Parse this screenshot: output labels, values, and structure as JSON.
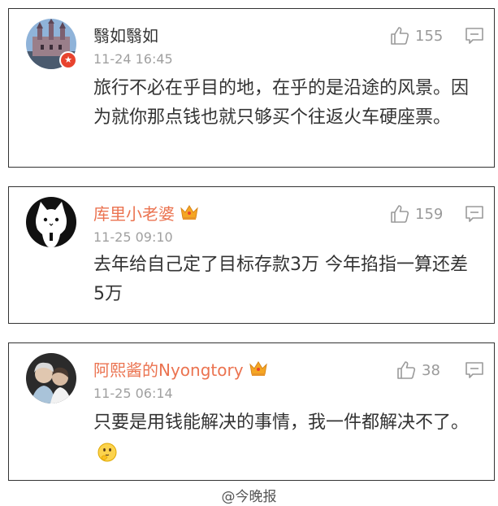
{
  "comments": [
    {
      "username": "翳如翳如",
      "timestamp": "11-24 16:45",
      "likes": "155",
      "content": "旅行不必在乎目的地，在乎的是沿途的风景。因为就你那点钱也就只够买个往返火车硬座票。",
      "verified_badge": "star-badge-icon",
      "has_crown": false,
      "has_emoji": false
    },
    {
      "username": "库里小老婆",
      "timestamp": "11-25 09:10",
      "likes": "159",
      "content": "去年给自己定了目标存款3万 今年掐指一算还差5万",
      "has_crown": true,
      "has_emoji": false
    },
    {
      "username": "阿熙酱的Nyongtory",
      "timestamp": "11-25 06:14",
      "likes": "38",
      "content": "只要是用钱能解决的事情，我一件都解决不了。",
      "has_crown": true,
      "has_emoji": true,
      "emoji": "thinking-face-icon"
    }
  ],
  "watermark": "@今晚报",
  "colors": {
    "vip_name": "#eb7350",
    "normal_name": "#333333",
    "meta_gray": "#a0a0a0",
    "badge_red": "#e8432e",
    "crown_gold": "#f5a623"
  }
}
